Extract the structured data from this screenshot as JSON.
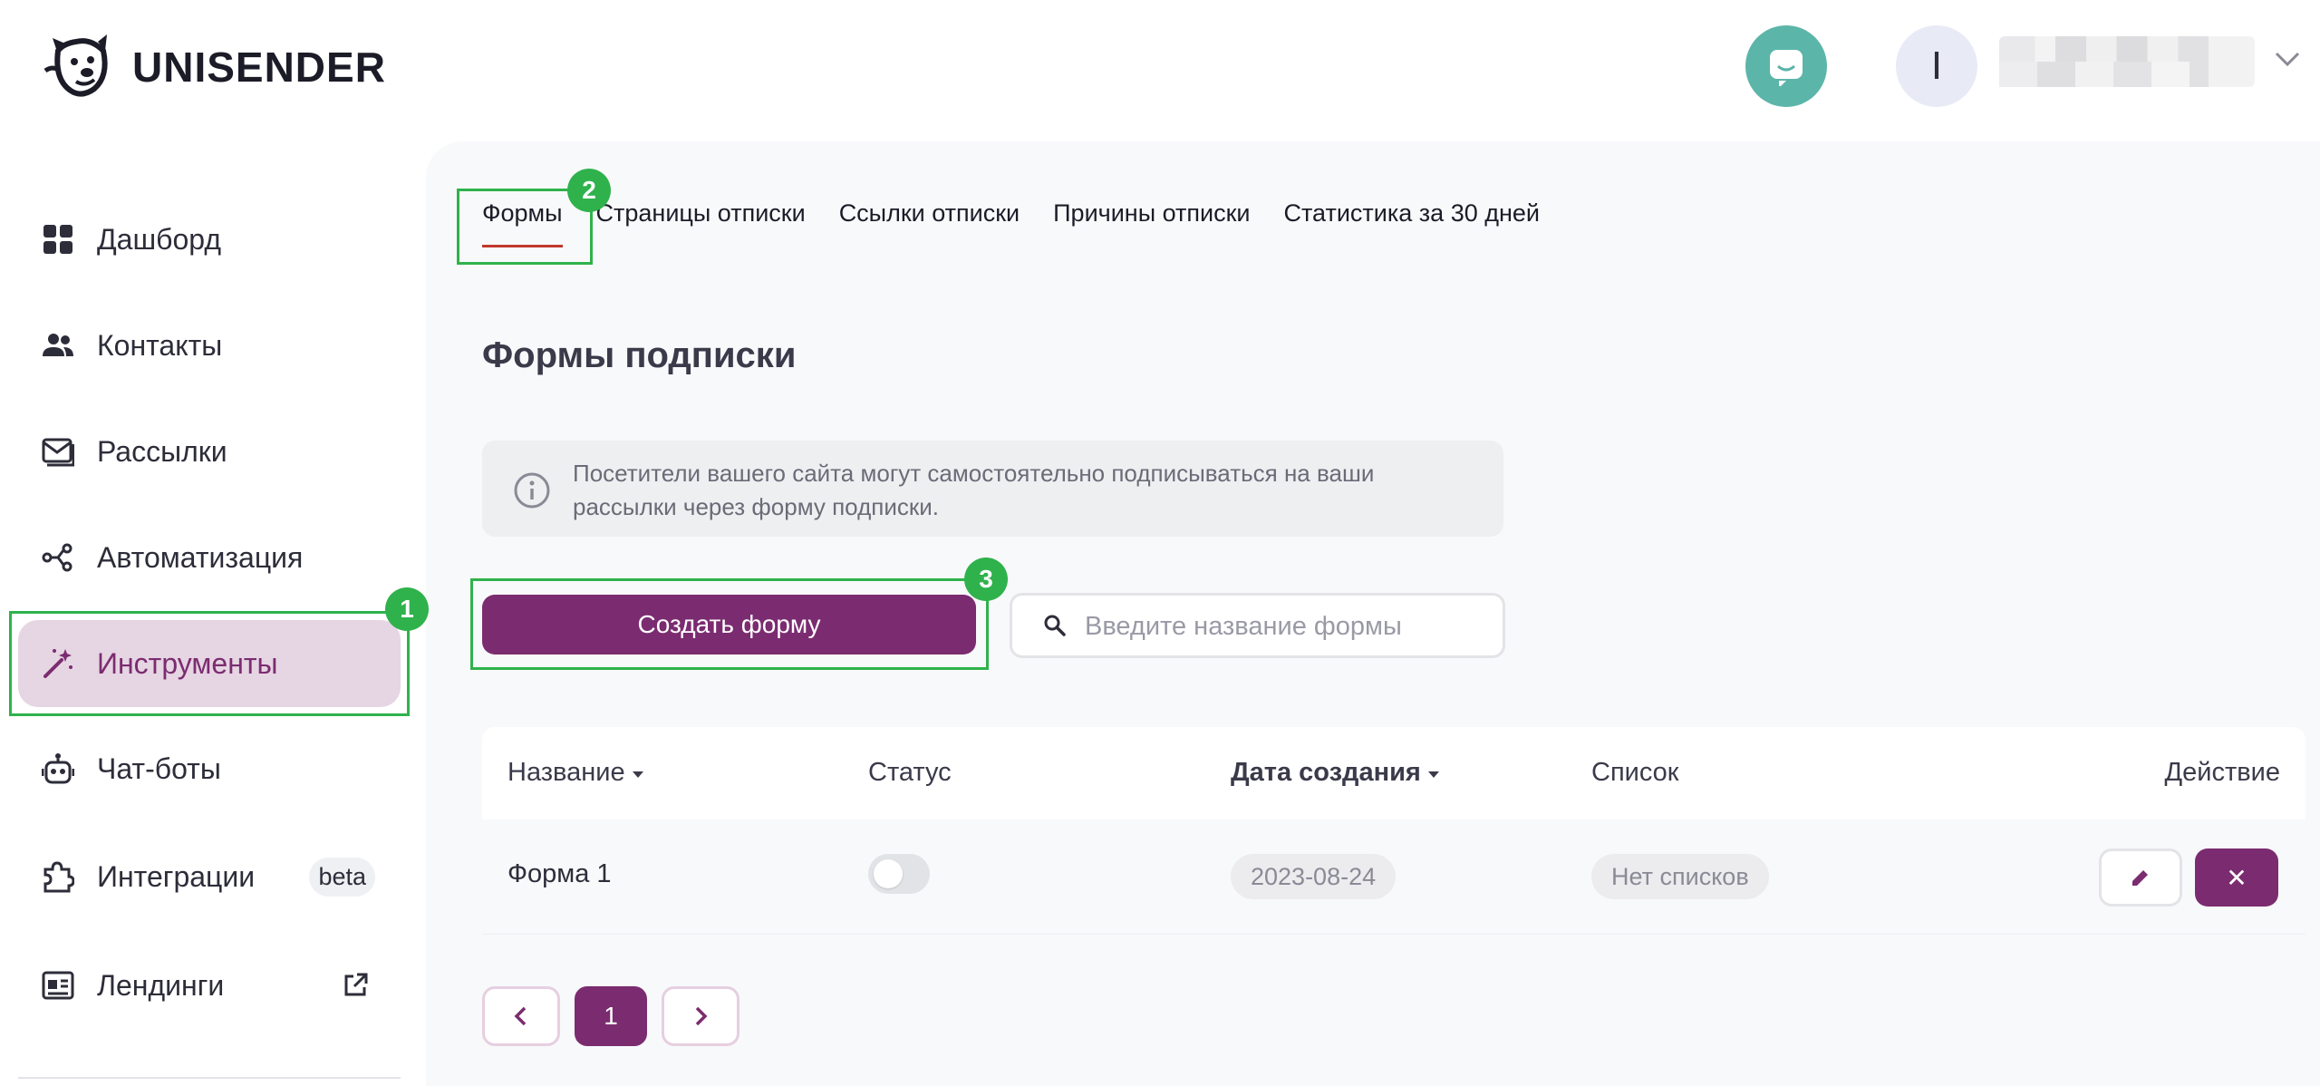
{
  "header": {
    "logo_text": "UNISENDER",
    "avatar_initial": "I"
  },
  "sidebar": {
    "items": [
      {
        "label": "Дашборд",
        "icon": "dashboard-icon"
      },
      {
        "label": "Контакты",
        "icon": "contacts-icon"
      },
      {
        "label": "Рассылки",
        "icon": "mail-icon"
      },
      {
        "label": "Автоматизация",
        "icon": "automation-icon"
      },
      {
        "label": "Инструменты",
        "icon": "magic-wand-icon",
        "active": true
      },
      {
        "label": "Чат-боты",
        "icon": "robot-icon"
      },
      {
        "label": "Интеграции",
        "icon": "puzzle-icon",
        "badge": "beta"
      },
      {
        "label": "Лендинги",
        "icon": "landing-icon",
        "external": true
      }
    ]
  },
  "tabs": [
    "Формы",
    "Страницы отписки",
    "Ссылки отписки",
    "Причины отписки",
    "Статистика за 30 дней"
  ],
  "active_tab": "Формы",
  "page": {
    "title": "Формы подписки",
    "info_text": "Посетители вашего сайта могут самостоятельно подписываться на ваши рассылки через форму подписки.",
    "create_button": "Создать форму",
    "search_placeholder": "Введите название формы"
  },
  "table": {
    "columns": [
      "Название",
      "Статус",
      "Дата создания",
      "Список",
      "Действие"
    ],
    "rows": [
      {
        "name": "Форма 1",
        "status_enabled": false,
        "created": "2023-08-24",
        "list": "Нет списков"
      }
    ]
  },
  "pagination": {
    "current_page": "1"
  },
  "annotations": [
    "1",
    "2",
    "3"
  ],
  "colors": {
    "brand": "#7b2c70",
    "active_bg": "#e6d5e3",
    "chat_button": "#5cb5a9",
    "annotation_green": "#2fb24c"
  }
}
